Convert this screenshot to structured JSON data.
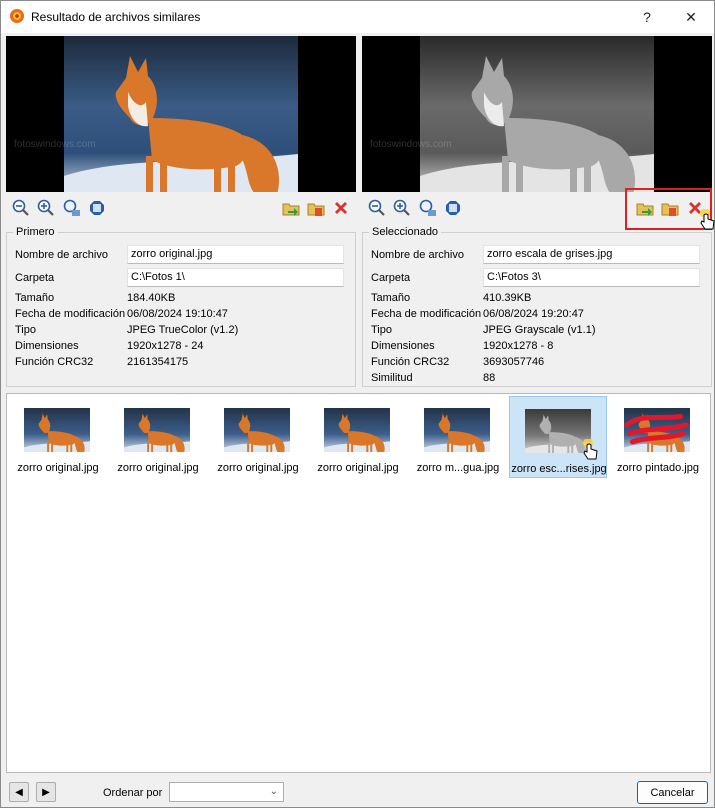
{
  "window": {
    "title": "Resultado de archivos similares",
    "help_label": "?",
    "close_label": "✕"
  },
  "preview": {
    "left_watermark": "fotoswindows.com",
    "right_watermark": "fotoswindows.com"
  },
  "primero": {
    "title": "Primero",
    "labels": {
      "name": "Nombre de archivo",
      "folder": "Carpeta",
      "size": "Tamaño",
      "modified": "Fecha de modificación",
      "type": "Tipo",
      "dimensions": "Dimensiones",
      "crc": "Función CRC32"
    },
    "values": {
      "name": "zorro original.jpg",
      "folder": "C:\\Fotos 1\\",
      "size": "184.40KB",
      "modified": "06/08/2024 19:10:47",
      "type": "JPEG TrueColor (v1.2)",
      "dimensions": "1920x1278 - 24",
      "crc": "2161354175"
    }
  },
  "seleccionado": {
    "title": "Seleccionado",
    "labels": {
      "name": "Nombre de archivo",
      "folder": "Carpeta",
      "size": "Tamaño",
      "modified": "Fecha de modificación",
      "type": "Tipo",
      "dimensions": "Dimensiones",
      "crc": "Función CRC32",
      "similarity": "Similitud"
    },
    "values": {
      "name": "zorro escala de grises.jpg",
      "folder": "C:\\Fotos 3\\",
      "size": "410.39KB",
      "modified": "06/08/2024 19:20:47",
      "type": "JPEG Grayscale (v1.1)",
      "dimensions": "1920x1278 - 8",
      "crc": "3693057746",
      "similarity": "88"
    }
  },
  "thumbnails": [
    {
      "label": "zorro original.jpg",
      "style": "color",
      "selected": false
    },
    {
      "label": "zorro original.jpg",
      "style": "color",
      "selected": false
    },
    {
      "label": "zorro original.jpg",
      "style": "color",
      "selected": false
    },
    {
      "label": "zorro original.jpg",
      "style": "color",
      "selected": false
    },
    {
      "label": "zorro m...gua.jpg",
      "style": "color",
      "selected": false
    },
    {
      "label": "zorro esc...rises.jpg",
      "style": "gray",
      "selected": true
    },
    {
      "label": "zorro pintado.jpg",
      "style": "painted",
      "selected": false
    }
  ],
  "bottom": {
    "prev_label": "◀",
    "next_label": "▶",
    "sort_label": "Ordenar por",
    "sort_value": "",
    "cancel_label": "Cancelar"
  },
  "colors": {
    "highlight": "#e0201c",
    "selected_bg": "#cce4f7",
    "accent": "#0067c0"
  }
}
